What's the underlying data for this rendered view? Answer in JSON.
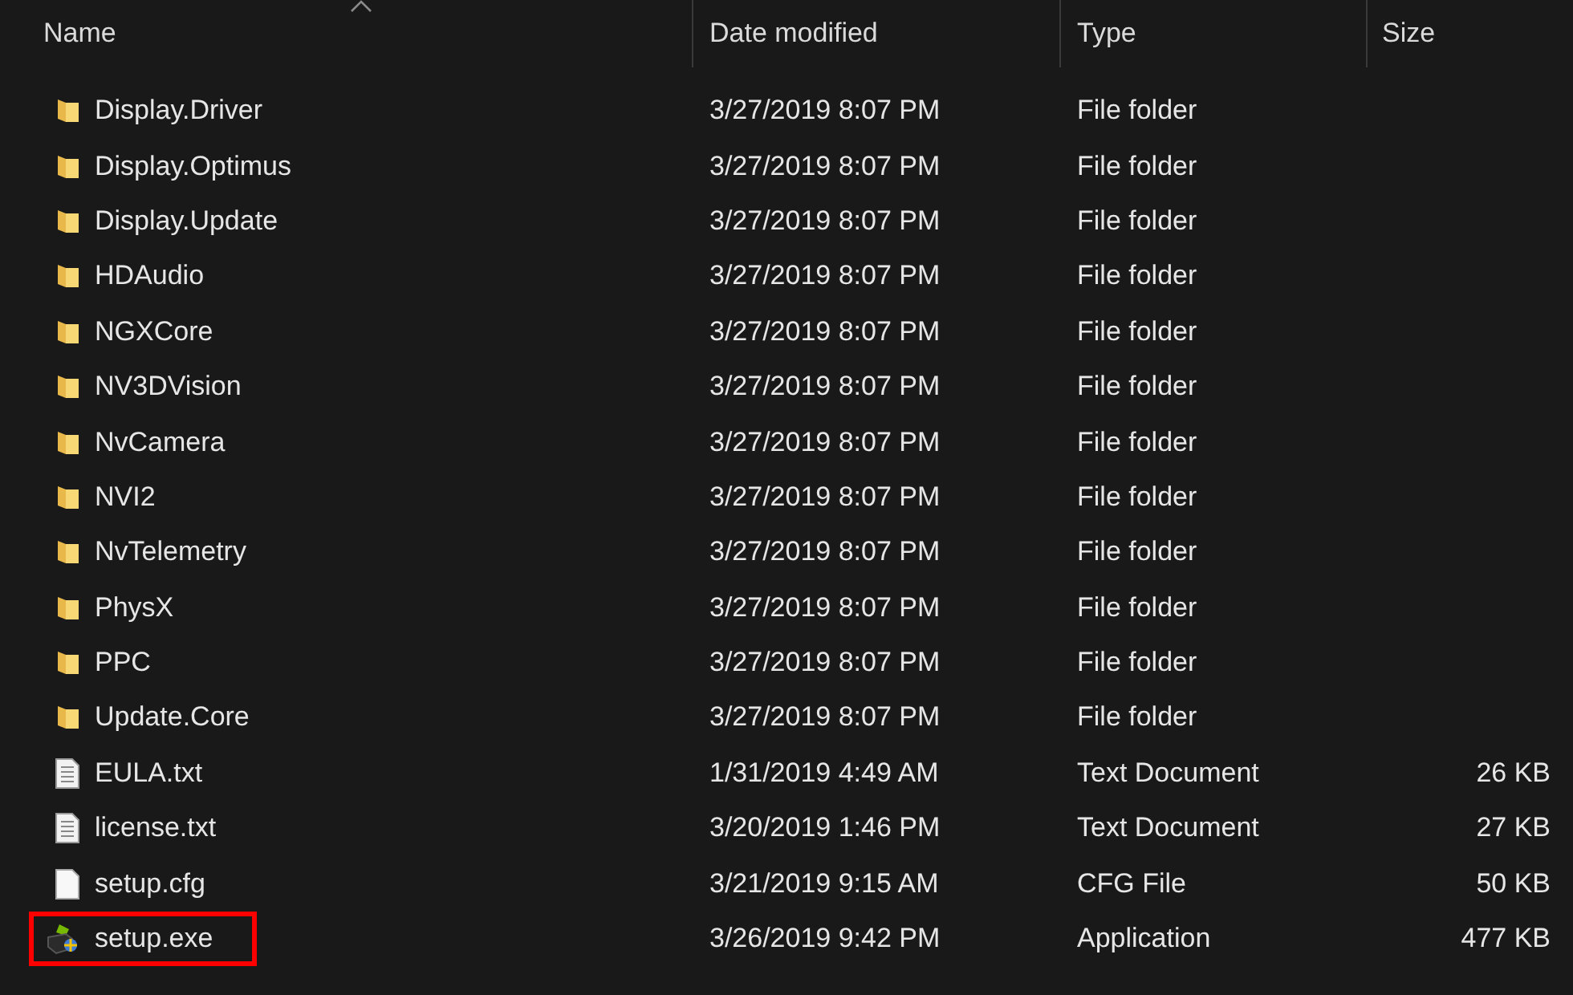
{
  "table": {
    "columns": [
      {
        "label": "Name",
        "sorted": true
      },
      {
        "label": "Date modified",
        "sorted": false
      },
      {
        "label": "Type",
        "sorted": false
      },
      {
        "label": "Size",
        "sorted": false
      }
    ],
    "rows": [
      {
        "kind": "folder",
        "name": "Display.Driver",
        "date": "3/27/2019 8:07 PM",
        "type": "File folder",
        "highlighted": false
      },
      {
        "kind": "folder",
        "name": "Display.Optimus",
        "date": "3/27/2019 8:07 PM",
        "type": "File folder",
        "highlighted": false
      },
      {
        "kind": "folder",
        "name": "Display.Update",
        "date": "3/27/2019 8:07 PM",
        "type": "File folder",
        "highlighted": false
      },
      {
        "kind": "folder",
        "name": "HDAudio",
        "date": "3/27/2019 8:07 PM",
        "type": "File folder",
        "highlighted": false
      },
      {
        "kind": "folder",
        "name": "NGXCore",
        "date": "3/27/2019 8:07 PM",
        "type": "File folder",
        "highlighted": false
      },
      {
        "kind": "folder",
        "name": "NV3DVision",
        "date": "3/27/2019 8:07 PM",
        "type": "File folder",
        "highlighted": false
      },
      {
        "kind": "folder",
        "name": "NvCamera",
        "date": "3/27/2019 8:07 PM",
        "type": "File folder",
        "highlighted": false
      },
      {
        "kind": "folder",
        "name": "NVI2",
        "date": "3/27/2019 8:07 PM",
        "type": "File folder",
        "highlighted": false
      },
      {
        "kind": "folder",
        "name": "NvTelemetry",
        "date": "3/27/2019 8:07 PM",
        "type": "File folder",
        "highlighted": false
      },
      {
        "kind": "folder",
        "name": "PhysX",
        "date": "3/27/2019 8:07 PM",
        "type": "File folder",
        "highlighted": false
      },
      {
        "kind": "folder",
        "name": "PPC",
        "date": "3/27/2019 8:07 PM",
        "type": "File folder",
        "highlighted": false
      },
      {
        "kind": "folder",
        "name": "Update.Core",
        "date": "3/27/2019 8:07 PM",
        "type": "File folder",
        "highlighted": false
      },
      {
        "kind": "text",
        "name": "EULA.txt",
        "date": "1/31/2019 4:49 AM",
        "type": "Text Document",
        "size": "26 KB",
        "highlighted": false
      },
      {
        "kind": "text",
        "name": "license.txt",
        "date": "3/20/2019 1:46 PM",
        "type": "Text Document",
        "size": "27 KB",
        "highlighted": false
      },
      {
        "kind": "blank",
        "name": "setup.cfg",
        "date": "3/21/2019 9:15 AM",
        "type": "CFG File",
        "size": "50 KB",
        "highlighted": false
      },
      {
        "kind": "app",
        "name": "setup.exe",
        "date": "3/26/2019 9:42 PM",
        "type": "Application",
        "size": "477 KB",
        "highlighted": true
      }
    ]
  }
}
